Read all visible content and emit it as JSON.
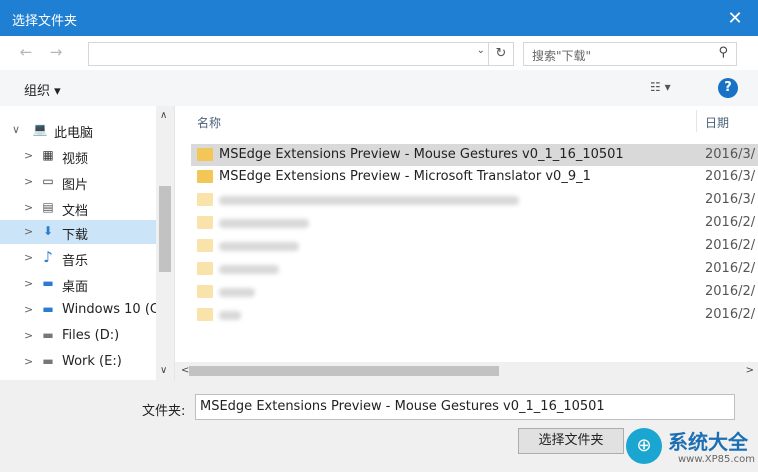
{
  "window": {
    "title": "选择文件夹",
    "close_glyph": "✕"
  },
  "nav": {
    "back_glyph": "←",
    "forward_glyph": "→",
    "dropdown_glyph": "⌄",
    "refresh_glyph": "↻"
  },
  "search": {
    "placeholder": "搜索\"下载\"",
    "icon_glyph": "⚲"
  },
  "toolbar": {
    "organize_label": "组织 ▾",
    "view_glyph": "☷ ▾",
    "help_glyph": "?"
  },
  "sidebar": {
    "items": [
      {
        "label": "此电脑",
        "arrow": "∨",
        "icon": "💻"
      },
      {
        "label": "视频",
        "arrow": ">",
        "icon": "▦"
      },
      {
        "label": "图片",
        "arrow": ">",
        "icon": "▭"
      },
      {
        "label": "文档",
        "arrow": ">",
        "icon": "▤"
      },
      {
        "label": "下载",
        "arrow": ">",
        "icon": "⬇"
      },
      {
        "label": "音乐",
        "arrow": ">",
        "icon": "♪"
      },
      {
        "label": "桌面",
        "arrow": ">",
        "icon": "▬"
      },
      {
        "label": "Windows 10 (C",
        "arrow": ">",
        "icon": "▬"
      },
      {
        "label": "Files (D:)",
        "arrow": ">",
        "icon": "▬"
      },
      {
        "label": "Work (E:)",
        "arrow": ">",
        "icon": "▬"
      }
    ],
    "scroll_up": "∧",
    "scroll_down": "∨"
  },
  "filelist": {
    "columns": {
      "name": "名称",
      "date": "日期"
    },
    "rows": [
      {
        "name": "MSEdge Extensions Preview - Mouse Gestures v0_1_16_10501",
        "date": "2016/3/"
      },
      {
        "name": "MSEdge Extensions Preview - Microsoft Translator v0_9_1",
        "date": "2016/3/"
      },
      {
        "name": "",
        "date": "2016/3/"
      },
      {
        "name": "",
        "date": "2016/2/"
      },
      {
        "name": "",
        "date": "2016/2/"
      },
      {
        "name": "",
        "date": "2016/2/"
      },
      {
        "name": "",
        "date": "2016/2/"
      },
      {
        "name": "",
        "date": "2016/2/"
      }
    ],
    "hscroll_left": "<",
    "hscroll_right": ">"
  },
  "bottom": {
    "folder_label": "文件夹:",
    "folder_value": "MSEdge Extensions Preview - Mouse Gestures v0_1_16_10501",
    "select_button": "选择文件夹"
  },
  "watermark": {
    "text": "系统大全",
    "url": "www.XP85.com",
    "logo_glyph": "⊕"
  }
}
